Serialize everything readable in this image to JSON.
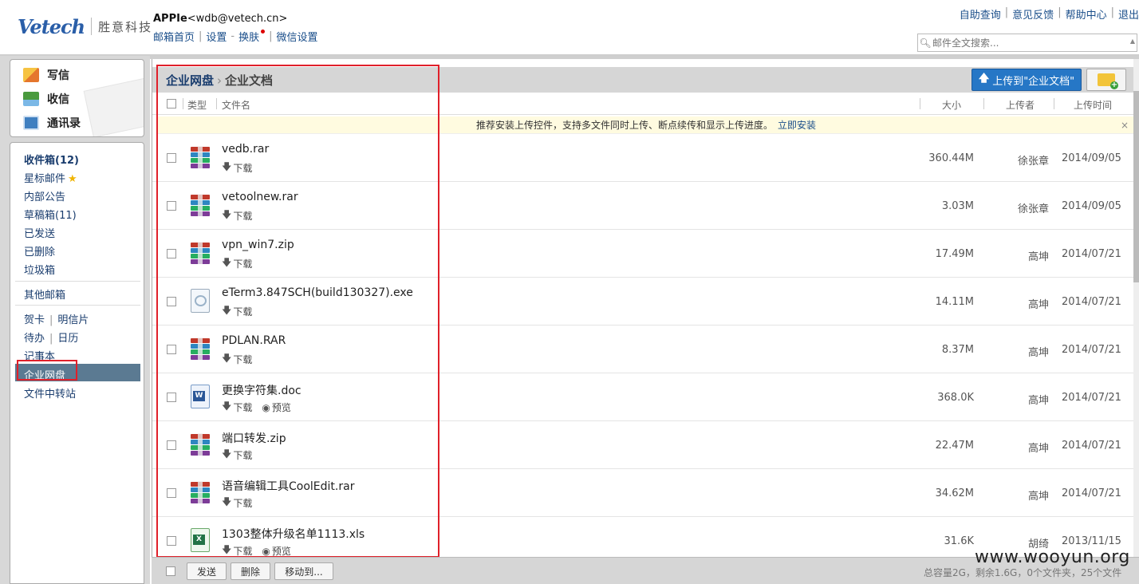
{
  "header": {
    "logo_mark": "Vetech",
    "logo_cn": "胜意科技",
    "user_name": "APPIe",
    "user_email": "<wdb@vetech.cn>",
    "account_links": [
      "邮箱首页",
      "设置",
      "换肤",
      "微信设置"
    ],
    "top_links": [
      "自助查询",
      "意见反馈",
      "帮助中心",
      "退出"
    ],
    "search_placeholder": "邮件全文搜索..."
  },
  "compose": {
    "items": [
      {
        "label": "写信",
        "icon": "compose-icon"
      },
      {
        "label": "收信",
        "icon": "inbox-download-icon"
      },
      {
        "label": "通讯录",
        "icon": "contacts-icon"
      }
    ]
  },
  "folders": {
    "inbox": "收件箱(12)",
    "starred": "星标邮件",
    "internal": "内部公告",
    "drafts": "草稿箱(11)",
    "sent": "已发送",
    "deleted": "已删除",
    "trash": "垃圾箱",
    "other": "其他邮箱",
    "greeting": "贺卡",
    "postcard": "明信片",
    "todo": "待办",
    "calendar": "日历",
    "notes": "记事本",
    "netdisk": "企业网盘",
    "transfer": "文件中转站"
  },
  "toolbar": {
    "breadcrumb_root": "企业网盘",
    "breadcrumb_current": "企业文档",
    "upload_label": "上传到\"企业文档\""
  },
  "columns": {
    "type": "类型",
    "filename": "文件名",
    "size": "大小",
    "uploader": "上传者",
    "upload_time": "上传时间"
  },
  "notice": {
    "text": "推荐安装上传控件，支持多文件同时上传、断点续传和显示上传进度。",
    "link": "立即安装",
    "close": "×"
  },
  "actions": {
    "download": "下载",
    "preview": "预览"
  },
  "files": [
    {
      "name": "vedb.rar",
      "type": "rar",
      "size": "360.44M",
      "uploader": "徐张章",
      "date": "2014/09/05",
      "preview": false
    },
    {
      "name": "vetoolnew.rar",
      "type": "rar",
      "size": "3.03M",
      "uploader": "徐张章",
      "date": "2014/09/05",
      "preview": false
    },
    {
      "name": "vpn_win7.zip",
      "type": "rar",
      "size": "17.49M",
      "uploader": "高坤",
      "date": "2014/07/21",
      "preview": false
    },
    {
      "name": "eTerm3.847SCH(build130327).exe",
      "type": "exe",
      "size": "14.11M",
      "uploader": "高坤",
      "date": "2014/07/21",
      "preview": false
    },
    {
      "name": "PDLAN.RAR",
      "type": "rar",
      "size": "8.37M",
      "uploader": "高坤",
      "date": "2014/07/21",
      "preview": false
    },
    {
      "name": "更换字符集.doc",
      "type": "doc",
      "size": "368.0K",
      "uploader": "高坤",
      "date": "2014/07/21",
      "preview": true
    },
    {
      "name": "端口转发.zip",
      "type": "rar",
      "size": "22.47M",
      "uploader": "高坤",
      "date": "2014/07/21",
      "preview": false
    },
    {
      "name": "语音编辑工具CoolEdit.rar",
      "type": "rar",
      "size": "34.62M",
      "uploader": "高坤",
      "date": "2014/07/21",
      "preview": false
    },
    {
      "name": "1303整体升级名单1113.xls",
      "type": "xls",
      "size": "31.6K",
      "uploader": "胡绮",
      "date": "2013/11/15",
      "preview": true
    }
  ],
  "bottom": {
    "send": "发送",
    "delete": "删除",
    "move": "移动到...",
    "quota": "总容量2G，剩余1.6G，0个文件夹，25个文件"
  },
  "watermark": "www.wooyun.org",
  "colors": {
    "accent": "#2677c6",
    "link": "#1a4e8a",
    "highlight_box": "#e0202a",
    "active_folder": "#5b7a92"
  }
}
